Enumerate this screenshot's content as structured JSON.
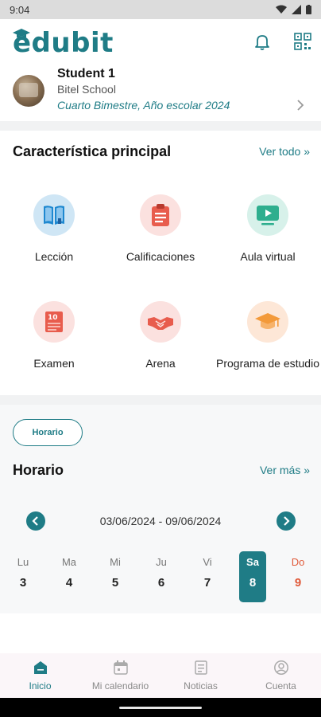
{
  "status_bar": {
    "time": "9:04"
  },
  "header": {
    "logo_text": "edubit"
  },
  "profile": {
    "name": "Student 1",
    "school": "Bitel School",
    "term": "Cuarto Bimestre, Año escolar 2024"
  },
  "features": {
    "title": "Característica principal",
    "see_all": "Ver todo »",
    "items": [
      {
        "label": "Lección",
        "icon": "book-icon",
        "color": "#cfe6f5"
      },
      {
        "label": "Calificaciones",
        "icon": "clipboard-icon",
        "color": "#fbe1df"
      },
      {
        "label": "Aula virtual",
        "icon": "video-icon",
        "color": "#d7f1ea"
      },
      {
        "label": "Examen",
        "icon": "exam-icon",
        "color": "#fbe1df"
      },
      {
        "label": "Arena",
        "icon": "handshake-icon",
        "color": "#fbe1df"
      },
      {
        "label": "Programa de estudio",
        "icon": "graduation-cap-icon",
        "color": "#fde7d7"
      }
    ]
  },
  "schedule": {
    "pill_label": "Horario",
    "title": "Horario",
    "see_more": "Ver más »",
    "week_range": "03/06/2024 - 09/06/2024",
    "days": [
      {
        "name": "Lu",
        "date": "3"
      },
      {
        "name": "Ma",
        "date": "4"
      },
      {
        "name": "Mi",
        "date": "5"
      },
      {
        "name": "Ju",
        "date": "6"
      },
      {
        "name": "Vi",
        "date": "7"
      },
      {
        "name": "Sa",
        "date": "8"
      },
      {
        "name": "Do",
        "date": "9"
      }
    ],
    "selected_day": "Sa"
  },
  "tabs": [
    {
      "label": "Inicio",
      "icon": "home-icon",
      "active": true
    },
    {
      "label": "Mi calendario",
      "icon": "calendar-icon",
      "active": false
    },
    {
      "label": "Noticias",
      "icon": "news-icon",
      "active": false
    },
    {
      "label": "Cuenta",
      "icon": "account-icon",
      "active": false
    }
  ],
  "colors": {
    "accent": "#1f7c86",
    "sunday": "#e05a3a"
  }
}
